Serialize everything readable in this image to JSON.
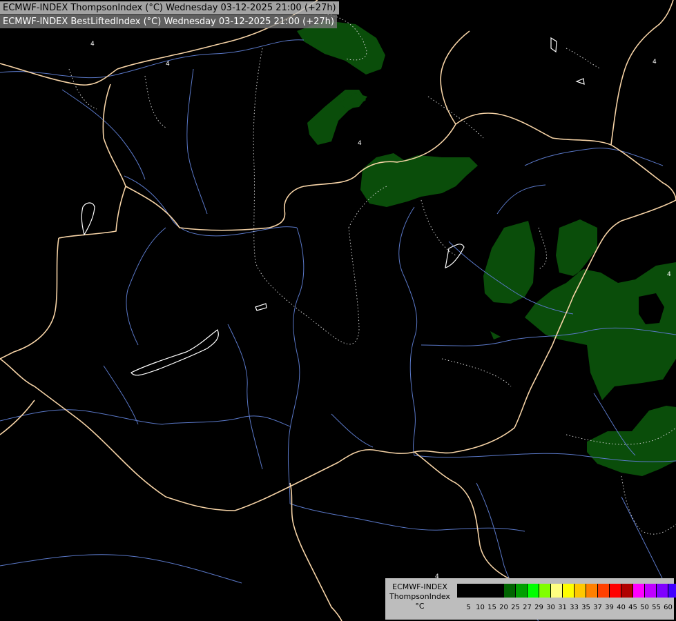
{
  "header": {
    "line1": "ECMWF-INDEX ThompsonIndex (°C) Wednesday 03-12-2025 21:00 (+27h)",
    "line2": "ECMWF-INDEX BestLiftedIndex (°C) Wednesday 03-12-2025 21:00 (+27h)"
  },
  "legend": {
    "title_line1": "ECMWF-INDEX",
    "title_line2": "ThompsonIndex",
    "title_line3": "°C",
    "colors": [
      "#000000",
      "#000000",
      "#000000",
      "#000000",
      "#006400",
      "#00a000",
      "#00ff00",
      "#80ff00",
      "#ffff80",
      "#ffff00",
      "#ffc800",
      "#ff8000",
      "#ff4000",
      "#ff0000",
      "#b00000",
      "#ff00ff",
      "#c000ff",
      "#8000ff",
      "#4000ff",
      "#0000ff"
    ],
    "ticks": [
      "5",
      "10",
      "15",
      "20",
      "25",
      "27",
      "29",
      "30",
      "31",
      "33",
      "35",
      "37",
      "39",
      "40",
      "45",
      "50",
      "55",
      "60"
    ]
  },
  "map_colors": {
    "background": "#000000",
    "area_fill": "#0a4d0a",
    "border": "#f6d3a6",
    "rivers": "#5a78c8",
    "contours": "#cccccc",
    "lakes": "#ffffff"
  },
  "contour_labels": [
    "4",
    "4",
    "4",
    "4",
    "4",
    "4"
  ]
}
